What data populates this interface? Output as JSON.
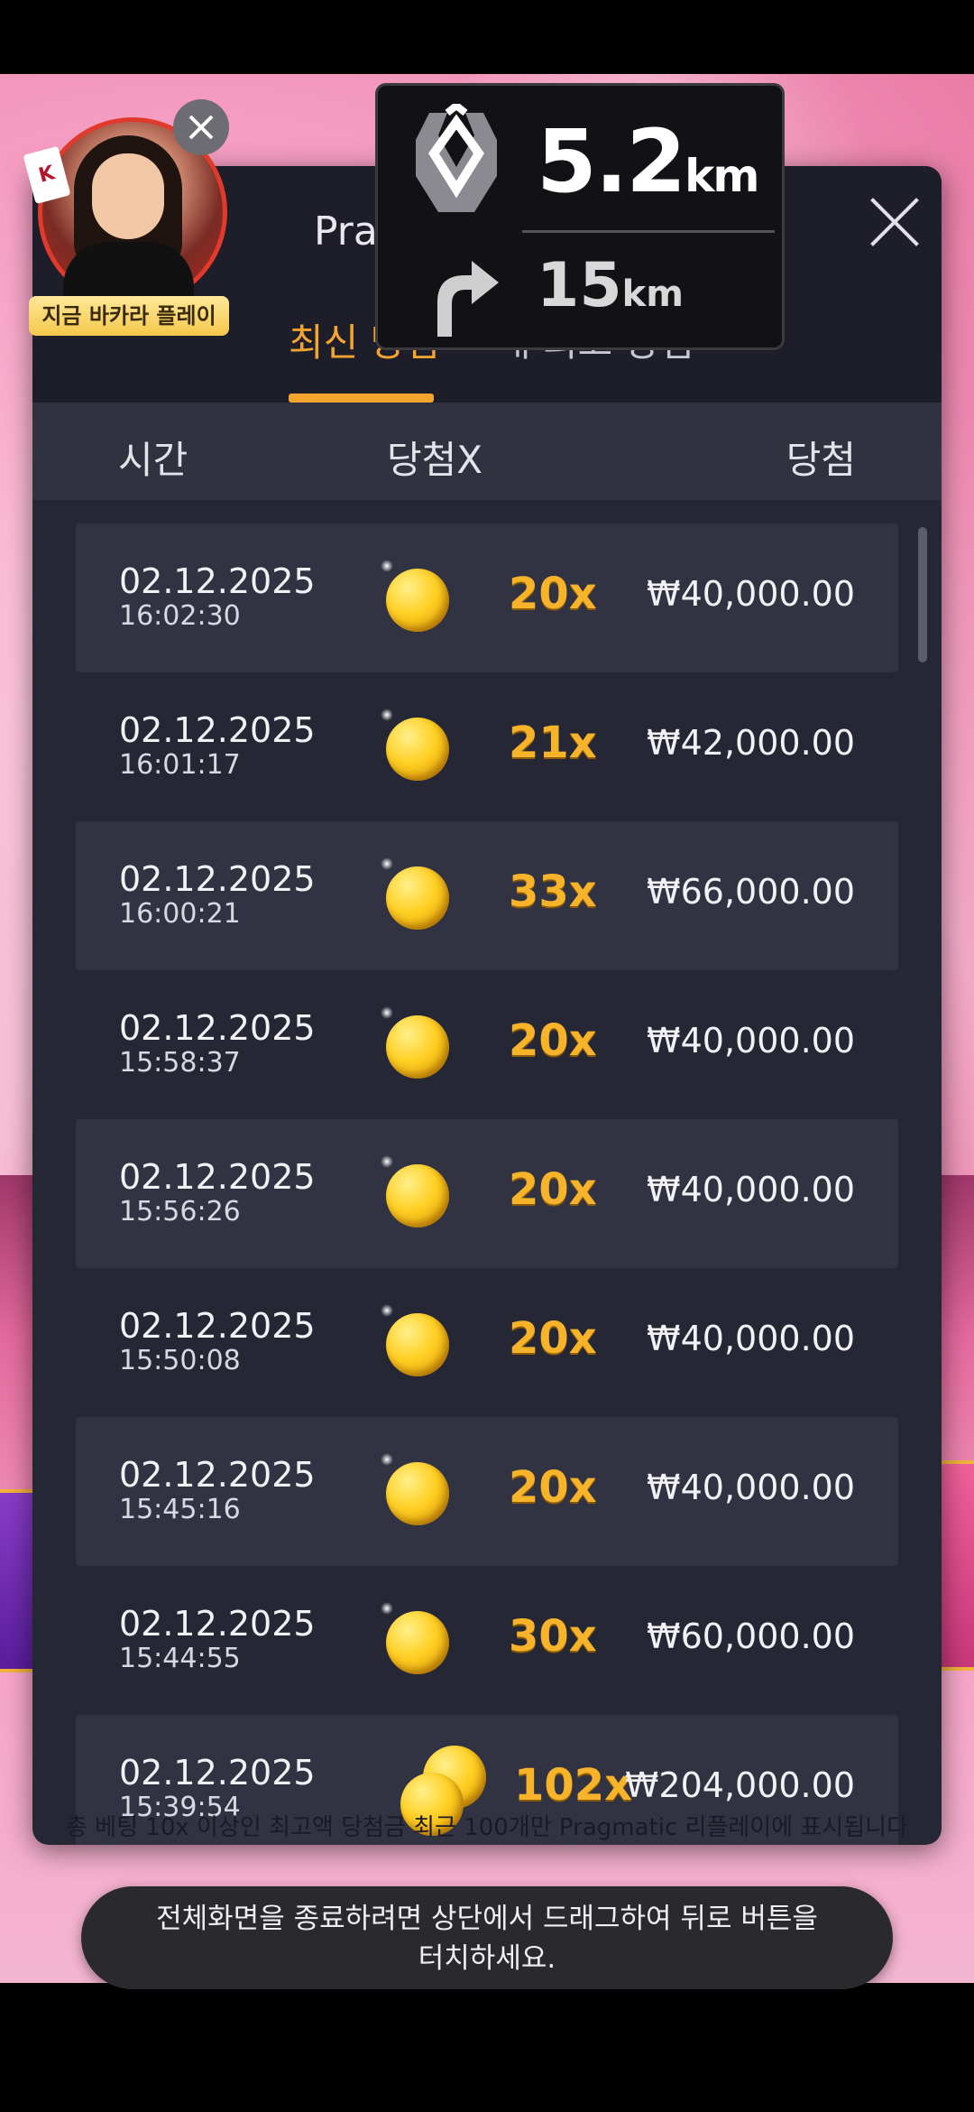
{
  "dialog": {
    "title": "Pragmatic 리플레이",
    "tabs": [
      {
        "label": "최신 당첨"
      },
      {
        "label": "내 최고 당첨"
      }
    ],
    "columns": {
      "time": "시간",
      "multiplier": "당첨X",
      "win": "당첨"
    },
    "rows": [
      {
        "date": "02.12.2025",
        "time": "16:02:30",
        "multiplier": "20x",
        "amount": "₩40,000.00"
      },
      {
        "date": "02.12.2025",
        "time": "16:01:17",
        "multiplier": "21x",
        "amount": "₩42,000.00"
      },
      {
        "date": "02.12.2025",
        "time": "16:00:21",
        "multiplier": "33x",
        "amount": "₩66,000.00"
      },
      {
        "date": "02.12.2025",
        "time": "15:58:37",
        "multiplier": "20x",
        "amount": "₩40,000.00"
      },
      {
        "date": "02.12.2025",
        "time": "15:56:26",
        "multiplier": "20x",
        "amount": "₩40,000.00"
      },
      {
        "date": "02.12.2025",
        "time": "15:50:08",
        "multiplier": "20x",
        "amount": "₩40,000.00"
      },
      {
        "date": "02.12.2025",
        "time": "15:45:16",
        "multiplier": "20x",
        "amount": "₩40,000.00"
      },
      {
        "date": "02.12.2025",
        "time": "15:44:55",
        "multiplier": "30x",
        "amount": "₩60,000.00"
      },
      {
        "date": "02.12.2025",
        "time": "15:39:54",
        "multiplier": "102x",
        "amount": "₩204,000.00"
      }
    ],
    "footnote": "총 베팅 10x 이상인 최고액 당첨금 최근 100개만 Pragmatic 리플레이에 표시됩니다"
  },
  "navigation": {
    "distance_value": "5.2",
    "distance_unit": "km",
    "next_value": "15",
    "next_unit": "km"
  },
  "promo": {
    "label": "지금 바카라 플레이",
    "card_text": "K"
  },
  "toast": {
    "message": "전체화면을 종료하려면 상단에서 드래그하여 뒤로 버튼을\n터치하세요."
  },
  "colors": {
    "accent": "#f3a530",
    "dialog_bg": "#262735",
    "row_alt": "#323342"
  },
  "icons": [
    "close-icon",
    "coin-icon",
    "navigation-direction-icon",
    "turn-right-arrow-icon"
  ]
}
